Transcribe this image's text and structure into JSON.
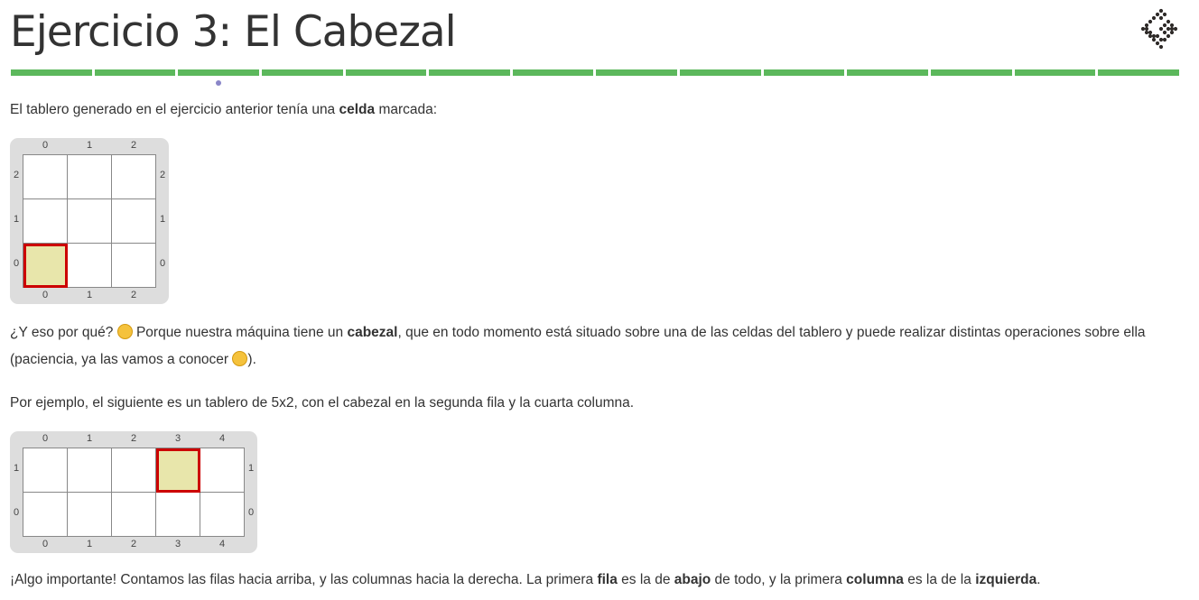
{
  "title": "Ejercicio 3: El Cabezal",
  "progress": {
    "segments": 14,
    "current": 3
  },
  "p1": {
    "a": "El tablero generado en el ejercicio anterior tenía una ",
    "b": "celda",
    "c": " marcada:"
  },
  "board1": {
    "cols": 3,
    "rows": 3,
    "head": [
      0,
      0
    ]
  },
  "p2": {
    "a": "¿Y eso por qué? ",
    "emoji1": "thinking-face",
    "b": " Porque nuestra máquina tiene un ",
    "c": "cabezal",
    "d": ", que en todo momento está situado sobre una de las celdas del tablero y puede realizar distintas operaciones sobre ella (paciencia, ya las vamos a conocer ",
    "emoji2": "grinning-face",
    "e": ")."
  },
  "p3": "Por ejemplo, el siguiente es un tablero de 5x2, con el cabezal en la segunda fila y la cuarta columna.",
  "board2": {
    "cols": 5,
    "rows": 2,
    "head": [
      3,
      1
    ]
  },
  "p4": {
    "a": "¡Algo importante! Contamos las filas hacia arriba, y las columnas hacia la derecha. La primera ",
    "b": "fila",
    "c": " es la de ",
    "d": "abajo",
    "e": " de todo, y la primera ",
    "f": "columna",
    "g": " es la de la ",
    "h": "izquierda",
    "i": "."
  }
}
